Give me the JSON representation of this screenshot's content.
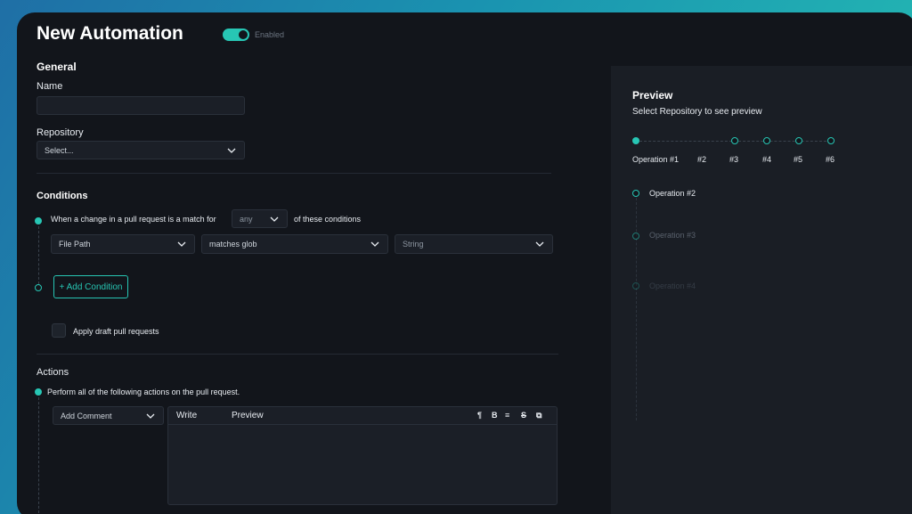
{
  "header": {
    "title": "New Automation",
    "toggle_label": "Enabled"
  },
  "general": {
    "heading": "General",
    "name_label": "Name",
    "name_value": "",
    "repository_label": "Repository",
    "repository_placeholder": "Select..."
  },
  "conditions": {
    "heading": "Conditions",
    "prefix": "When a change in a pull request is a match for",
    "match_mode": "any",
    "suffix": "of these conditions",
    "field": "File Path",
    "operator": "matches glob",
    "value_placeholder": "String",
    "add_label": "+ Add Condition",
    "draft_label": "Apply draft pull requests"
  },
  "actions": {
    "heading": "Actions",
    "description": "Perform all of the following actions on the pull request.",
    "action_type": "Add Comment",
    "write_tab": "Write",
    "preview_tab": "Preview",
    "tools": [
      "¶",
      "B",
      "≡",
      "S",
      "⧉"
    ]
  },
  "preview": {
    "title": "Preview",
    "subtitle": "Select Repository to see preview",
    "steps": [
      "Operation #1",
      "#2",
      "#3",
      "#4",
      "#5",
      "#6"
    ],
    "operations": [
      "Operation #2",
      "Operation #3",
      "Operation #4"
    ]
  },
  "colors": {
    "accent": "#27c6b4",
    "background": "#12151b",
    "panel": "#1a1e25"
  }
}
